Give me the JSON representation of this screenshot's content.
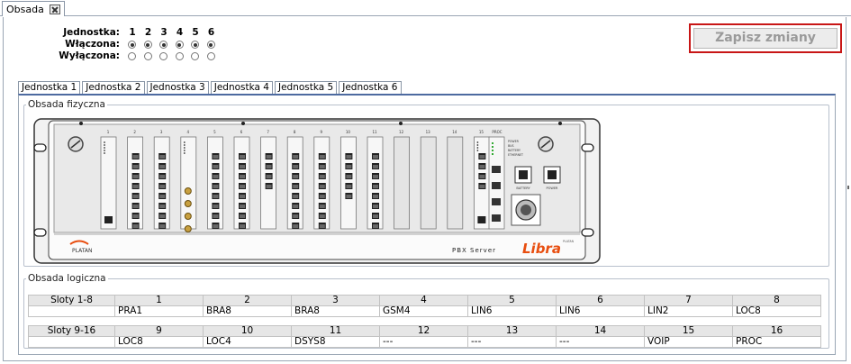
{
  "window": {
    "tab_label": "Obsada"
  },
  "selector": {
    "unit_label": "Jednostka:",
    "on_label": "Włączona:",
    "off_label": "Wyłączona:",
    "units": [
      "1",
      "2",
      "3",
      "4",
      "5",
      "6"
    ],
    "on_state": [
      true,
      true,
      true,
      true,
      true,
      true
    ]
  },
  "save_button": {
    "label": "Zapisz zmiany"
  },
  "unit_tabs": [
    "Jednostka 1",
    "Jednostka 2",
    "Jednostka 3",
    "Jednostka 4",
    "Jednostka 5",
    "Jednostka 6"
  ],
  "active_tab": 0,
  "physical": {
    "legend": "Obsada fizyczna",
    "slot_numbers": [
      "1",
      "2",
      "3",
      "4",
      "5",
      "6",
      "7",
      "8",
      "9",
      "10",
      "11",
      "12",
      "13",
      "14",
      "15",
      "PROC"
    ],
    "proc_labels": [
      "POWER",
      "BUS",
      "BATTERY",
      "ETHERNET"
    ],
    "battery_label": "BATTERY",
    "power_label": "POWER",
    "brand_left": "PLATAN",
    "brand_right": "PBX Server",
    "brand_logo": "Libra",
    "brand_small": "PLATAN"
  },
  "logical": {
    "legend": "Obsada logiczna",
    "rows": [
      {
        "label": "Sloty 1-8",
        "slots": [
          "1",
          "2",
          "3",
          "4",
          "5",
          "6",
          "7",
          "8"
        ],
        "cards": [
          "PRA1",
          "BRA8",
          "BRA8",
          "GSM4",
          "LIN6",
          "LIN6",
          "LIN2",
          "LOC8"
        ]
      },
      {
        "label": "Sloty 9-16",
        "slots": [
          "9",
          "10",
          "11",
          "12",
          "13",
          "14",
          "15",
          "16"
        ],
        "cards": [
          "LOC8",
          "LOC4",
          "DSYS8",
          "---",
          "---",
          "---",
          "VOIP",
          "PROC"
        ]
      }
    ]
  },
  "colors": {
    "accent": "#4d6aa0",
    "save_border": "#c81616",
    "logo": "#e84e10"
  }
}
